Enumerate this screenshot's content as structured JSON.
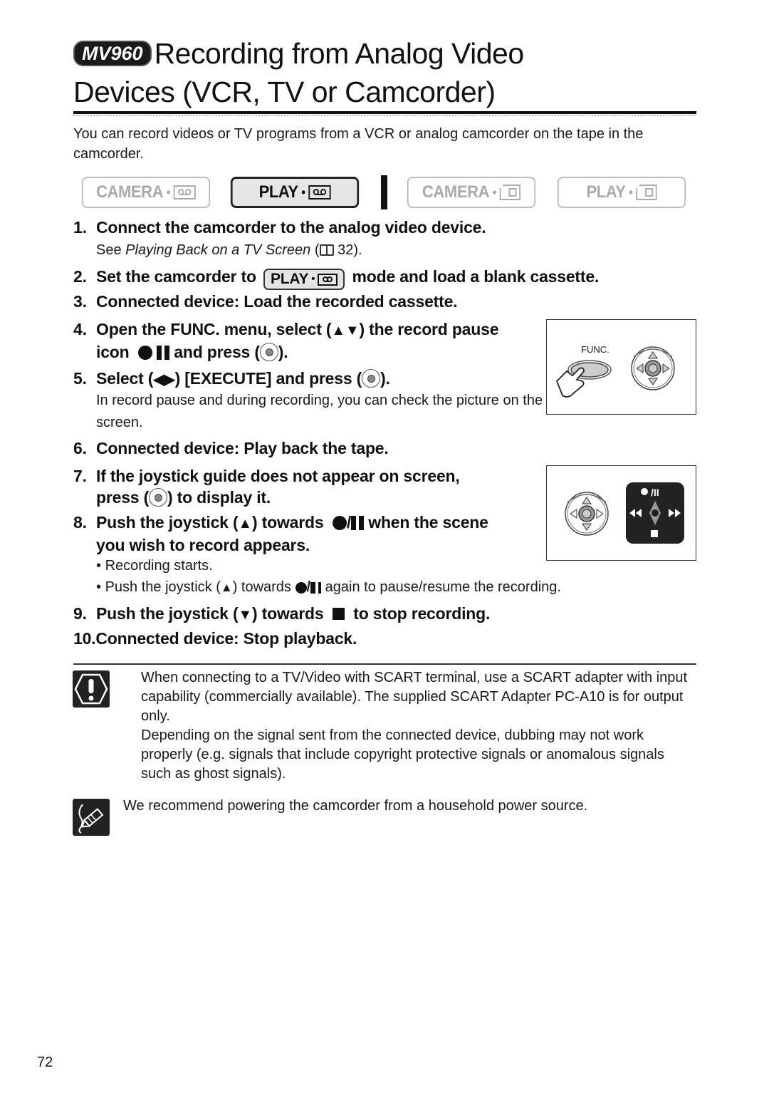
{
  "header": {
    "model_badge": "MV960",
    "title_line1": "Recording from Analog Video",
    "title_line2": "Devices (VCR, TV or Camcorder)"
  },
  "intro": "You can record videos or TV programs from a VCR or analog camcorder on the tape in the camcorder.",
  "modes": [
    {
      "label": "CAMERA",
      "media": "tape",
      "active": false
    },
    {
      "label": "PLAY",
      "media": "tape",
      "active": true
    },
    {
      "label": "CAMERA",
      "media": "card",
      "active": false
    },
    {
      "label": "PLAY",
      "media": "card",
      "active": false
    }
  ],
  "steps": {
    "s1": {
      "num": "1.",
      "text": "Connect the camcorder to the analog video device."
    },
    "s1_sub": {
      "prefix": "See ",
      "ref_title": "Playing Back on a TV Screen",
      "ref_open": " (",
      "ref_page": " 32)."
    },
    "s2": {
      "num": "2.",
      "before": "Set the camcorder to",
      "mode_label": "PLAY",
      "after": "mode and load a blank cassette."
    },
    "s3": {
      "num": "3.",
      "text": "Connected device: Load the recorded cassette."
    },
    "s4": {
      "num": "4.",
      "line1_a": "Open the FUNC. menu, select (",
      "line1_arrows": "▲▼",
      "line1_b": ") the record pause",
      "line2_a": "icon",
      "line2_b": "and press (",
      "line2_c": ")."
    },
    "s5": {
      "num": "5.",
      "a": "Select (",
      "arrows": "◀▶",
      "b": ") [EXECUTE] and press (",
      "c": ")."
    },
    "s5_sub": "In record pause and during recording, you can check the picture on the screen.",
    "s6": {
      "num": "6.",
      "text": "Connected device: Play back the tape."
    },
    "s7": {
      "num": "7.",
      "line1": "If the joystick guide does not appear on screen,",
      "line2_a": "press (",
      "line2_b": ") to display it."
    },
    "s8": {
      "num": "8.",
      "a": "Push the joystick (",
      "arrow": "▲",
      "b": ") towards",
      "slash": "/",
      "c": "when the scene",
      "line2": "you wish to record appears."
    },
    "s8_bullets": [
      {
        "text": "Recording starts."
      },
      {
        "a": "Push the joystick (",
        "arrow": "▲",
        "b": ") towards",
        "slash": "/",
        "c": "again to pause/resume the recording."
      }
    ],
    "s9": {
      "num": "9.",
      "a": "Push the joystick (",
      "arrow": "▼",
      "b": ") towards",
      "c": "to stop recording."
    },
    "s10": {
      "num": "10.",
      "text": "Connected device: Stop playback."
    }
  },
  "figures": {
    "func": {
      "label": "FUNC."
    },
    "joystick_guide": {
      "top": "●/II",
      "left": "◀◀",
      "right": "▶▶",
      "bottom": "■"
    }
  },
  "notes": {
    "caution_icon": "caution-icon",
    "caution_p1": "When connecting to a TV/Video with SCART terminal, use a SCART adapter with input capability (commercially available). The supplied SCART Adapter PC-A10 is for output only.",
    "caution_p2": "Depending on the signal sent from the connected device, dubbing may not work properly (e.g. signals that include copyright protective signals or anomalous signals such as ghost signals).",
    "tip_icon": "pencil-note-icon",
    "tip_text": "We recommend powering the camcorder from a household power source."
  },
  "page_number": "72"
}
